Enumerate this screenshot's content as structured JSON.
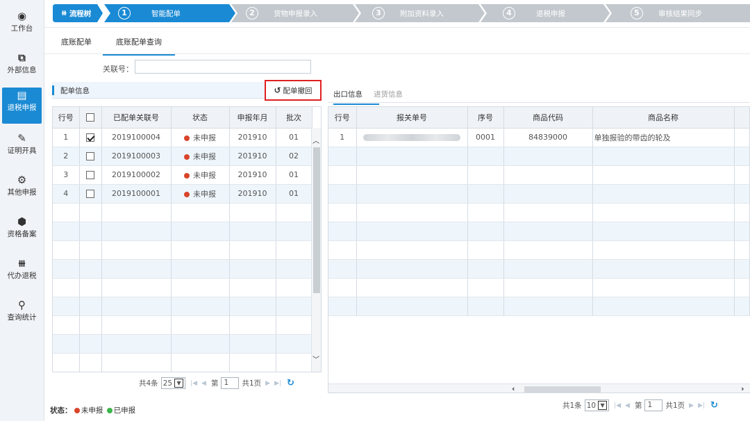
{
  "sidebar": {
    "items": [
      {
        "label": "工作台",
        "icon": "dashboard-icon",
        "glyph": "◉"
      },
      {
        "label": "外部信息",
        "icon": "external-info-icon",
        "glyph": "⧉"
      },
      {
        "label": "退税申报",
        "icon": "document-icon",
        "glyph": "▤"
      },
      {
        "label": "证明开具",
        "icon": "edit-icon",
        "glyph": "✎"
      },
      {
        "label": "其他申报",
        "icon": "gears-icon",
        "glyph": "⚙"
      },
      {
        "label": "资格备案",
        "icon": "cube-icon",
        "glyph": "⬢"
      },
      {
        "label": "代办退税",
        "icon": "org-chart-icon",
        "glyph": "⧻"
      },
      {
        "label": "查询统计",
        "icon": "search-icon",
        "glyph": "⚲"
      }
    ],
    "active_index": 2
  },
  "flow": {
    "tree_label": "流程树",
    "steps": [
      {
        "num": "1",
        "label": "智能配单"
      },
      {
        "num": "2",
        "label": "货物申报录入"
      },
      {
        "num": "3",
        "label": "附加资料录入"
      },
      {
        "num": "4",
        "label": "退税申报"
      },
      {
        "num": "5",
        "label": "审核结果同步"
      }
    ],
    "colors": {
      "active": "#1a8ad4",
      "inactive": "#c2c8ce"
    }
  },
  "tabs": {
    "t1": "底账配单",
    "t2": "底账配单查询"
  },
  "search": {
    "label": "关联号：",
    "value": ""
  },
  "left_panel": {
    "title": "配单信息",
    "recall_label": "配单撤回",
    "columns": {
      "rownum": "行号",
      "linked": "已配单关联号",
      "status": "状态",
      "period": "申报年月",
      "batch": "批次"
    },
    "rows": [
      {
        "n": "1",
        "checked": true,
        "linked": "2019100004",
        "status": "未申报",
        "period": "201910",
        "batch": "01"
      },
      {
        "n": "2",
        "checked": false,
        "linked": "2019100003",
        "status": "未申报",
        "period": "201910",
        "batch": "02"
      },
      {
        "n": "3",
        "checked": false,
        "linked": "2019100002",
        "status": "未申报",
        "period": "201910",
        "batch": "01"
      },
      {
        "n": "4",
        "checked": false,
        "linked": "2019100001",
        "status": "未申报",
        "period": "201910",
        "batch": "01"
      }
    ],
    "pager": {
      "total": "共4条",
      "page_size": "25",
      "page_label": "第",
      "page_num": "1",
      "pages": "共1页"
    }
  },
  "legend": {
    "prefix": "状态：",
    "unreported": "未申报",
    "reported": "已申报"
  },
  "status_colors": {
    "unreported": "#d9452b",
    "reported": "#3cb54a"
  },
  "right_panel": {
    "tabs": {
      "export": "出口信息",
      "import": "进货信息"
    },
    "columns": {
      "rownum": "行号",
      "customs": "报关单号",
      "seq": "序号",
      "code": "商品代码",
      "name": "商品名称"
    },
    "rows": [
      {
        "n": "1",
        "seq": "0001",
        "code": "84839000",
        "name": "单独报验的带齿的轮及"
      }
    ],
    "pager": {
      "total": "共1条",
      "page_size": "10",
      "page_label": "第",
      "page_num": "1",
      "pages": "共1页"
    }
  }
}
